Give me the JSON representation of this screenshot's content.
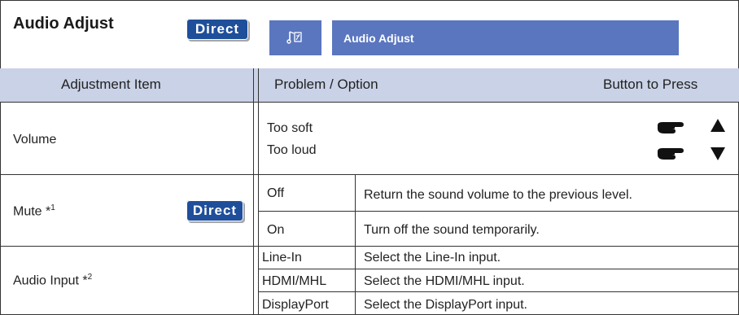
{
  "title": "Audio Adjust",
  "direct_label": "Direct",
  "osd": {
    "icon": "audio-note-icon",
    "label": "Audio Adjust",
    "color": "#5a76bf"
  },
  "header": {
    "adjustment_item": "Adjustment Item",
    "problem_option": "Problem / Option",
    "button_to_press": "Button to Press",
    "color": "#c9d2e6"
  },
  "rows": {
    "volume": {
      "item": "Volume",
      "too_soft": "Too soft",
      "too_loud": "Too loud"
    },
    "mute": {
      "item": "Mute *",
      "footnote": "1",
      "options": [
        {
          "option": "Off",
          "description": "Return the sound volume to the previous level."
        },
        {
          "option": "On",
          "description": "Turn off the sound temporarily."
        }
      ]
    },
    "audio_input": {
      "item": "Audio Input *",
      "footnote": "2",
      "options": [
        {
          "option": "Line-In",
          "description": "Select the Line-In input."
        },
        {
          "option": "HDMI/MHL",
          "description": "Select the HDMI/MHL input."
        },
        {
          "option": "DisplayPort",
          "description": "Select the DisplayPort input."
        }
      ]
    }
  },
  "accent_color": "#1f4f9a"
}
